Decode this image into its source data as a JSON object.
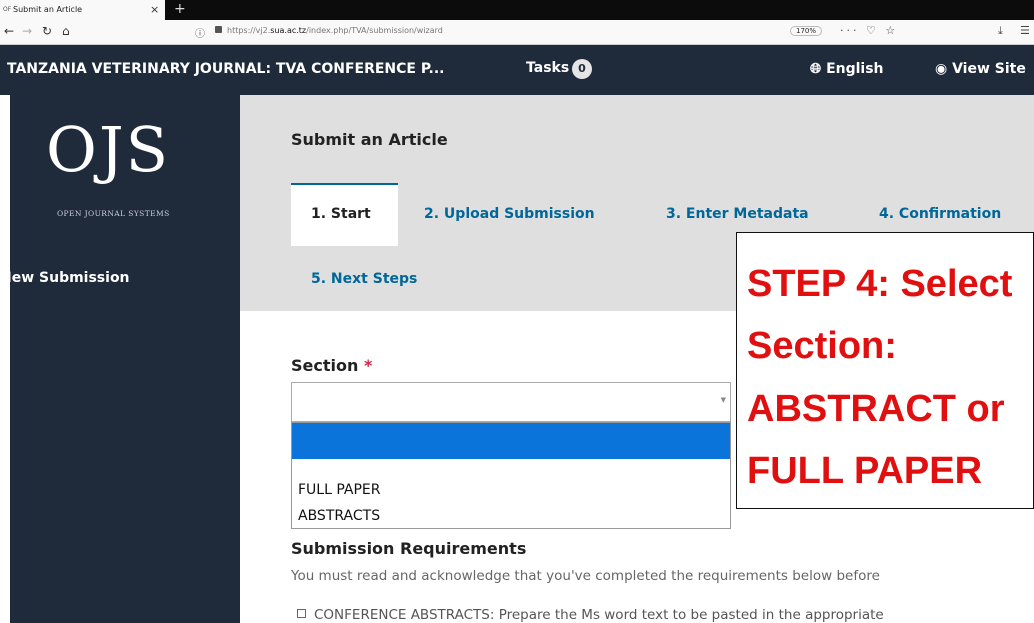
{
  "browser": {
    "tab_title": "Submit an Article",
    "tab_favicon": "OF",
    "close_glyph": "×",
    "new_tab_glyph": "+",
    "url_prefix": "https://vj2.",
    "url_domain": "sua.ac.tz",
    "url_path": "/index.php/TVA/submission/wizard",
    "zoom": "170%",
    "url_actions": "··· ♡ ☆"
  },
  "header": {
    "journal_title": "TANZANIA VETERINARY JOURNAL: TVA CONFERENCE P...",
    "tasks_label": "Tasks",
    "tasks_count": "0",
    "language_label": "English",
    "view_site_label": "View Site"
  },
  "sidebar": {
    "logo_text": "OJS",
    "logo_subtitle": "OPEN JOURNAL SYSTEMS",
    "new_submission_label": "New Submission"
  },
  "main": {
    "title": "Submit an Article",
    "tabs": [
      {
        "label": "1. Start",
        "active": true
      },
      {
        "label": "2. Upload Submission",
        "active": false
      },
      {
        "label": "3. Enter Metadata",
        "active": false
      },
      {
        "label": "4. Confirmation",
        "active": false
      },
      {
        "label": "5. Next Steps",
        "active": false
      }
    ],
    "section_label": "Section",
    "required_mark": "*",
    "section_selected_value": "",
    "section_options": [
      "",
      "FULL PAPER",
      "ABSTRACTS"
    ],
    "requirements_title": "Submission Requirements",
    "requirements_text": "You must read and acknowledge that you've completed the requirements below before",
    "requirement_1": "CONFERENCE ABSTRACTS: Prepare the Ms word text to be pasted in the appropriate"
  },
  "annotation": {
    "lines": [
      "STEP 4: Select",
      "Section:",
      "ABSTRACT or",
      "FULL PAPER"
    ],
    "color": "#e01010"
  },
  "colors": {
    "sidebar_bg": "#1f2b3b",
    "link_blue": "#006798",
    "selected_option": "#0a74da"
  }
}
